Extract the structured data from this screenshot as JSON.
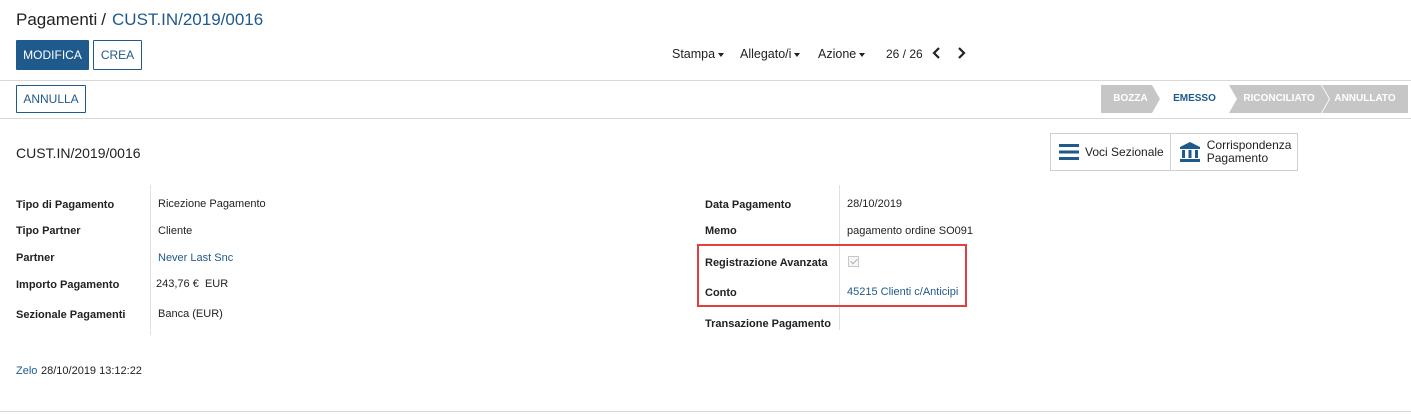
{
  "breadcrumb": {
    "parent": "Pagamenti",
    "separator": "/",
    "current": "CUST.IN/2019/0016"
  },
  "buttons": {
    "edit": "MODIFICA",
    "create": "CREA",
    "cancel": "ANNULLA"
  },
  "toolbar": {
    "print": "Stampa",
    "attachments": "Allegato/i",
    "action": "Azione"
  },
  "pager": {
    "value": "26 / 26"
  },
  "status_bar": {
    "stages": [
      {
        "label": "BOZZA",
        "active": false
      },
      {
        "label": "EMESSO",
        "active": true
      },
      {
        "label": "RICONCILIATO",
        "active": false
      },
      {
        "label": "ANNULLATO",
        "active": false
      }
    ]
  },
  "record": {
    "title": "CUST.IN/2019/0016"
  },
  "smart_buttons": {
    "journal_items": "Voci Sezionale",
    "payment_matching_line1": "Corrispondenza",
    "payment_matching_line2": "Pagamento"
  },
  "left_fields": {
    "payment_type": {
      "label": "Tipo di Pagamento",
      "value": "Ricezione Pagamento"
    },
    "partner_type": {
      "label": "Tipo Partner",
      "value": "Cliente"
    },
    "partner": {
      "label": "Partner",
      "value": "Never Last Snc"
    },
    "amount": {
      "label": "Importo Pagamento",
      "value": "243,76 €",
      "currency": "EUR"
    },
    "journal": {
      "label": "Sezionale Pagamenti",
      "value": "Banca (EUR)"
    }
  },
  "right_fields": {
    "payment_date": {
      "label": "Data Pagamento",
      "value": "28/10/2019"
    },
    "memo": {
      "label": "Memo",
      "value": "pagamento ordine SO091"
    },
    "advanced_registration": {
      "label": "Registrazione Avanzata",
      "checked": true
    },
    "account": {
      "label": "Conto",
      "value": "45215 Clienti c/Anticipi"
    },
    "payment_transaction": {
      "label": "Transazione Pagamento",
      "value": ""
    }
  },
  "footer": {
    "user": "Zelo",
    "datetime": "28/10/2019 13:12:22"
  },
  "colors": {
    "primary": "#1f5a8c",
    "highlight": "#e0403e",
    "stage_inactive": "#c6c6c6"
  }
}
